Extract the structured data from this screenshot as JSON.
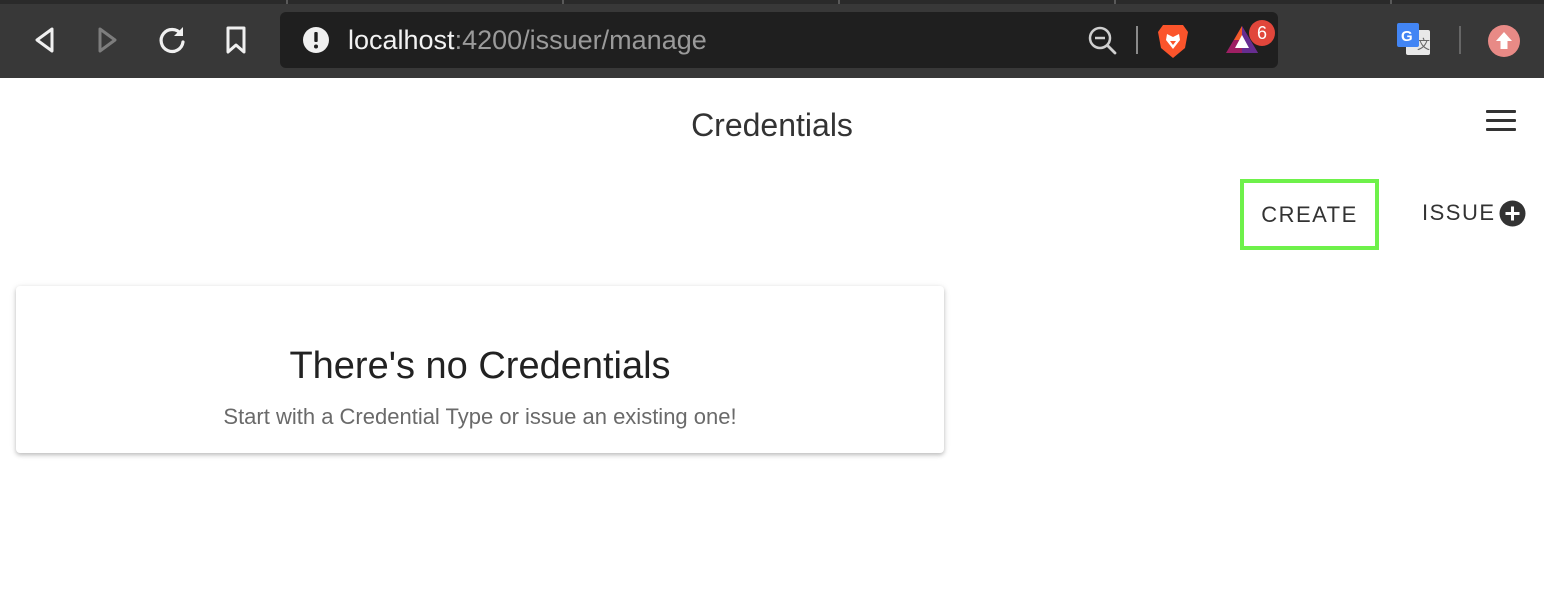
{
  "browser": {
    "url_host": "localhost",
    "url_path": ":4200/issuer/manage",
    "rewards_badge": "6",
    "icons": [
      "back-icon",
      "forward-icon",
      "reload-icon",
      "bookmark-icon",
      "site-info-icon",
      "zoom-out-icon",
      "brave-shields-icon",
      "brave-rewards-icon",
      "translate-icon",
      "profile-icon"
    ]
  },
  "header": {
    "title": "Credentials",
    "menu_icon": "hamburger-menu-icon"
  },
  "actions": {
    "create_label": "CREATE",
    "issue_label": "ISSUE",
    "issue_icon": "plus-circle-icon",
    "highlight_color": "#6ef14a"
  },
  "empty_state": {
    "title": "There's no Credentials",
    "subtitle": "Start with a Credential Type or issue an existing one!"
  }
}
